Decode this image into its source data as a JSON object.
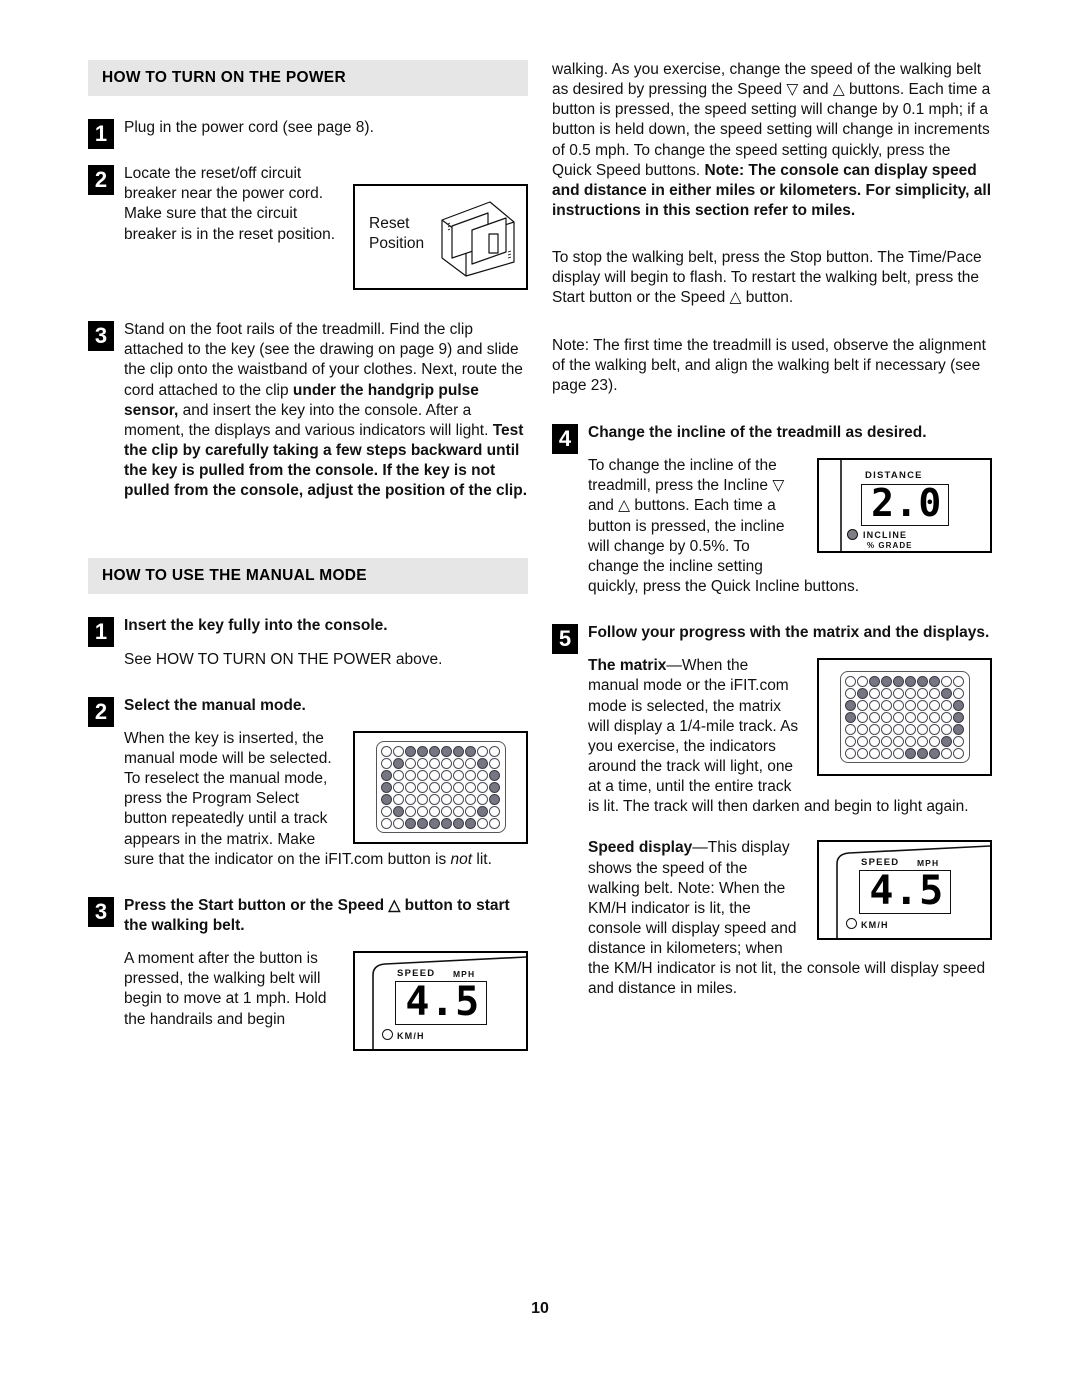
{
  "page": {
    "number": "10"
  },
  "left_column": {
    "section1": {
      "heading": "HOW TO TURN ON THE POWER",
      "steps": [
        {
          "num": "1",
          "text": "Plug in the power cord (see page 8)."
        },
        {
          "num": "2",
          "text": "Locate the reset/off circuit breaker near the power cord. Make sure that the circuit breaker is in the reset position."
        },
        {
          "num": "3",
          "text_plain_1": "Stand on the foot rails of the treadmill. Find the clip attached to the key (see the drawing on page 9) and slide the clip onto the waistband of your clothes. Next, route the cord attached to the clip ",
          "text_bold_1": "under the handgrip pulse sensor,",
          "text_plain_2": " and insert the key into the console. After a moment, the displays and various indicators will light. ",
          "text_bold_2": "Test the clip by carefully taking a few steps backward until the key is pulled from the console. If the key is not pulled from the console, adjust the position of the clip."
        }
      ],
      "figure_reset": {
        "label_line1": "Reset",
        "label_line2": "Position"
      }
    },
    "section2": {
      "heading": "HOW TO USE THE MANUAL MODE",
      "step1": {
        "num": "1",
        "title": "Insert the key fully into the console.",
        "body": "See HOW TO TURN ON THE POWER above."
      },
      "step2": {
        "num": "2",
        "title": "Select the manual mode.",
        "body_part1": "When the key is inserted, the manual mode will be selected. To reselect the manual mode, press the Program Select button repeatedly until a track appears in the matrix. Make sure that the indicator on the iFIT.com button is ",
        "body_italic": "not",
        "body_part2": " lit."
      },
      "step3": {
        "num": "3",
        "title_part1": "Press the Start button or the Speed ",
        "title_triangle": "up-triangle",
        "title_part2": " button to start the walking belt.",
        "body": "A moment after the button is pressed, the walking belt will begin to move at 1 mph. Hold the handrails and begin"
      },
      "figure_speed": {
        "label": "SPEED",
        "unit": "MPH",
        "value": "4.5",
        "indicator": "KM/H"
      }
    }
  },
  "right_column": {
    "continued_paragraph": {
      "plain": "walking. As you exercise, change the speed of the walking belt as desired by pressing the Speed ▽ and △ buttons. Each time a button is pressed, the speed setting will change by 0.1 mph; if a button is held down, the speed setting will change in increments of 0.5 mph. To change the speed setting quickly, press the Quick Speed buttons. ",
      "bold": "Note: The console can display speed and distance in either miles or kilometers. For simplicity, all instructions in this section refer to miles."
    },
    "para_stop": "To stop the walking belt, press the Stop button. The Time/Pace display will begin to flash. To restart the walking belt, press the Start button or the Speed △ button.",
    "para_note": "Note: The first time the treadmill is used, observe the alignment of the walking belt, and align the walking belt if necessary (see page 23).",
    "step4": {
      "num": "4",
      "title": "Change the incline of the treadmill as desired.",
      "body": "To change the incline of the treadmill, press the Incline ▽ and △ buttons. Each time a button is pressed, the incline will change by 0.5%. To change the incline setting quickly, press the Quick Incline buttons."
    },
    "figure_distance": {
      "label": "DISTANCE",
      "value": "2.0",
      "indicator_line1": "INCLINE",
      "indicator_line2": "% GRADE"
    },
    "step5": {
      "num": "5",
      "title": "Follow your progress with the matrix and the displays.",
      "matrix_bold": "The matrix",
      "matrix_body": "—When the manual mode or the iFIT.com mode is selected, the matrix will display a 1/4-mile track. As you exercise, the indicators around the track will light, one at a time, until the entire track is lit. The track will then darken and begin to light again.",
      "speed_bold": "Speed display",
      "speed_body": "—This display shows the speed of the walking belt. Note: When the KM/H indicator is lit, the console will display speed and distance in kilometers; when the KM/H indicator is not lit, the console will display speed and distance in miles."
    },
    "figure_speed": {
      "label": "SPEED",
      "unit": "MPH",
      "value": "4.5",
      "indicator": "KM/H"
    }
  },
  "matrix_full": {
    "rows": 7,
    "cols": 10,
    "pattern": [
      [
        0,
        0,
        1,
        1,
        1,
        1,
        1,
        1,
        0,
        0
      ],
      [
        0,
        1,
        0,
        0,
        0,
        0,
        0,
        0,
        1,
        0
      ],
      [
        1,
        0,
        0,
        0,
        0,
        0,
        0,
        0,
        0,
        1
      ],
      [
        1,
        0,
        0,
        0,
        0,
        0,
        0,
        0,
        0,
        1
      ],
      [
        1,
        0,
        0,
        0,
        0,
        0,
        0,
        0,
        0,
        1
      ],
      [
        0,
        1,
        0,
        0,
        0,
        0,
        0,
        0,
        1,
        0
      ],
      [
        0,
        0,
        1,
        1,
        1,
        1,
        1,
        1,
        0,
        0
      ]
    ]
  },
  "matrix_partial": {
    "rows": 7,
    "cols": 10,
    "pattern": [
      [
        0,
        0,
        1,
        1,
        1,
        1,
        1,
        1,
        0,
        0
      ],
      [
        0,
        1,
        0,
        0,
        0,
        0,
        0,
        0,
        1,
        0
      ],
      [
        1,
        0,
        0,
        0,
        0,
        0,
        0,
        0,
        0,
        1
      ],
      [
        1,
        0,
        0,
        0,
        0,
        0,
        0,
        0,
        0,
        1
      ],
      [
        0,
        0,
        0,
        0,
        0,
        0,
        0,
        0,
        0,
        1
      ],
      [
        0,
        0,
        0,
        0,
        0,
        0,
        0,
        0,
        1,
        0
      ],
      [
        0,
        0,
        0,
        0,
        0,
        1,
        1,
        1,
        0,
        0
      ]
    ]
  }
}
